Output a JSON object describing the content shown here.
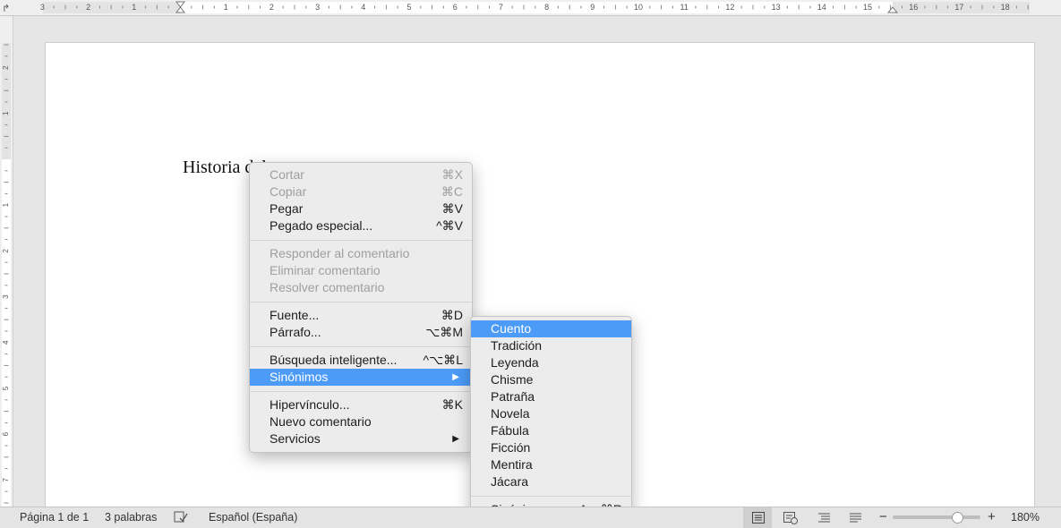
{
  "ruler_top": {
    "labels": [
      "3",
      "2",
      "1",
      "1",
      "2",
      "3",
      "4",
      "5",
      "6",
      "7",
      "8",
      "9",
      "10",
      "11",
      "12",
      "13",
      "14",
      "15",
      "16",
      "17",
      "18"
    ]
  },
  "ruler_left": {
    "labels": [
      "2",
      "1",
      "1",
      "2",
      "3",
      "4",
      "5",
      "6",
      "7"
    ]
  },
  "document": {
    "text": "Historia del cuento"
  },
  "context_menu": {
    "items": [
      {
        "label": "Cortar",
        "shortcut": "⌘X"
      },
      {
        "label": "Copiar",
        "shortcut": "⌘C"
      },
      {
        "label": "Pegar",
        "shortcut": "⌘V"
      },
      {
        "label": "Pegado especial...",
        "shortcut": "^⌘V"
      },
      {
        "label": "Responder al comentario",
        "shortcut": ""
      },
      {
        "label": "Eliminar comentario",
        "shortcut": ""
      },
      {
        "label": "Resolver comentario",
        "shortcut": ""
      },
      {
        "label": "Fuente...",
        "shortcut": "⌘D"
      },
      {
        "label": "Párrafo...",
        "shortcut": "⌥⌘M"
      },
      {
        "label": "Búsqueda inteligente...",
        "shortcut": "^⌥⌘L"
      },
      {
        "label": "Sinónimos",
        "shortcut": "▶"
      },
      {
        "label": "Hipervínculo...",
        "shortcut": "⌘K"
      },
      {
        "label": "Nuevo comentario",
        "shortcut": ""
      },
      {
        "label": "Servicios",
        "shortcut": "▶"
      }
    ]
  },
  "synonyms_menu": {
    "items": [
      "Cuento",
      "Tradición",
      "Leyenda",
      "Chisme",
      "Patraña",
      "Novela",
      "Fábula",
      "Ficción",
      "Mentira",
      "Jácara"
    ],
    "footer": {
      "label": "Sinónimos...",
      "shortcut": "^⌥⌘R"
    }
  },
  "status_bar": {
    "page": "Página 1 de 1",
    "words": "3 palabras",
    "language": "Español (España)",
    "zoom_minus": "−",
    "zoom_plus": "+",
    "zoom": "180%",
    "zoom_level_percent": 73
  }
}
